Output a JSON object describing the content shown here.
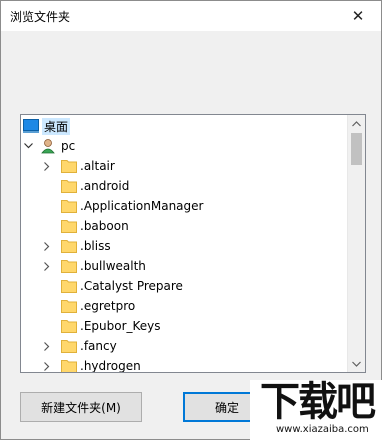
{
  "window": {
    "title": "浏览文件夹",
    "close_glyph": "✕"
  },
  "tree": {
    "root": {
      "label": "桌面",
      "icon": "desktop-icon"
    },
    "computer": {
      "label": "pc",
      "icon": "user-icon",
      "expanded": true
    },
    "folders": [
      {
        "label": ".altair",
        "expandable": true
      },
      {
        "label": ".android",
        "expandable": false
      },
      {
        "label": ".ApplicationManager",
        "expandable": false
      },
      {
        "label": ".baboon",
        "expandable": false
      },
      {
        "label": ".bliss",
        "expandable": true
      },
      {
        "label": ".bullwealth",
        "expandable": true
      },
      {
        "label": ".Catalyst Prepare",
        "expandable": false
      },
      {
        "label": ".egretpro",
        "expandable": false
      },
      {
        "label": ".Epubor_Keys",
        "expandable": false
      },
      {
        "label": ".fancy",
        "expandable": true
      },
      {
        "label": ".hydrogen",
        "expandable": true
      }
    ]
  },
  "buttons": {
    "new_folder": "新建文件夹(M)",
    "ok": "确定"
  },
  "watermark": {
    "logo": "下载吧",
    "url": "www.xiazaiba.com"
  },
  "colors": {
    "selection": "#cce8ff",
    "folder": "#ffd76b",
    "accent": "#0078d7"
  }
}
